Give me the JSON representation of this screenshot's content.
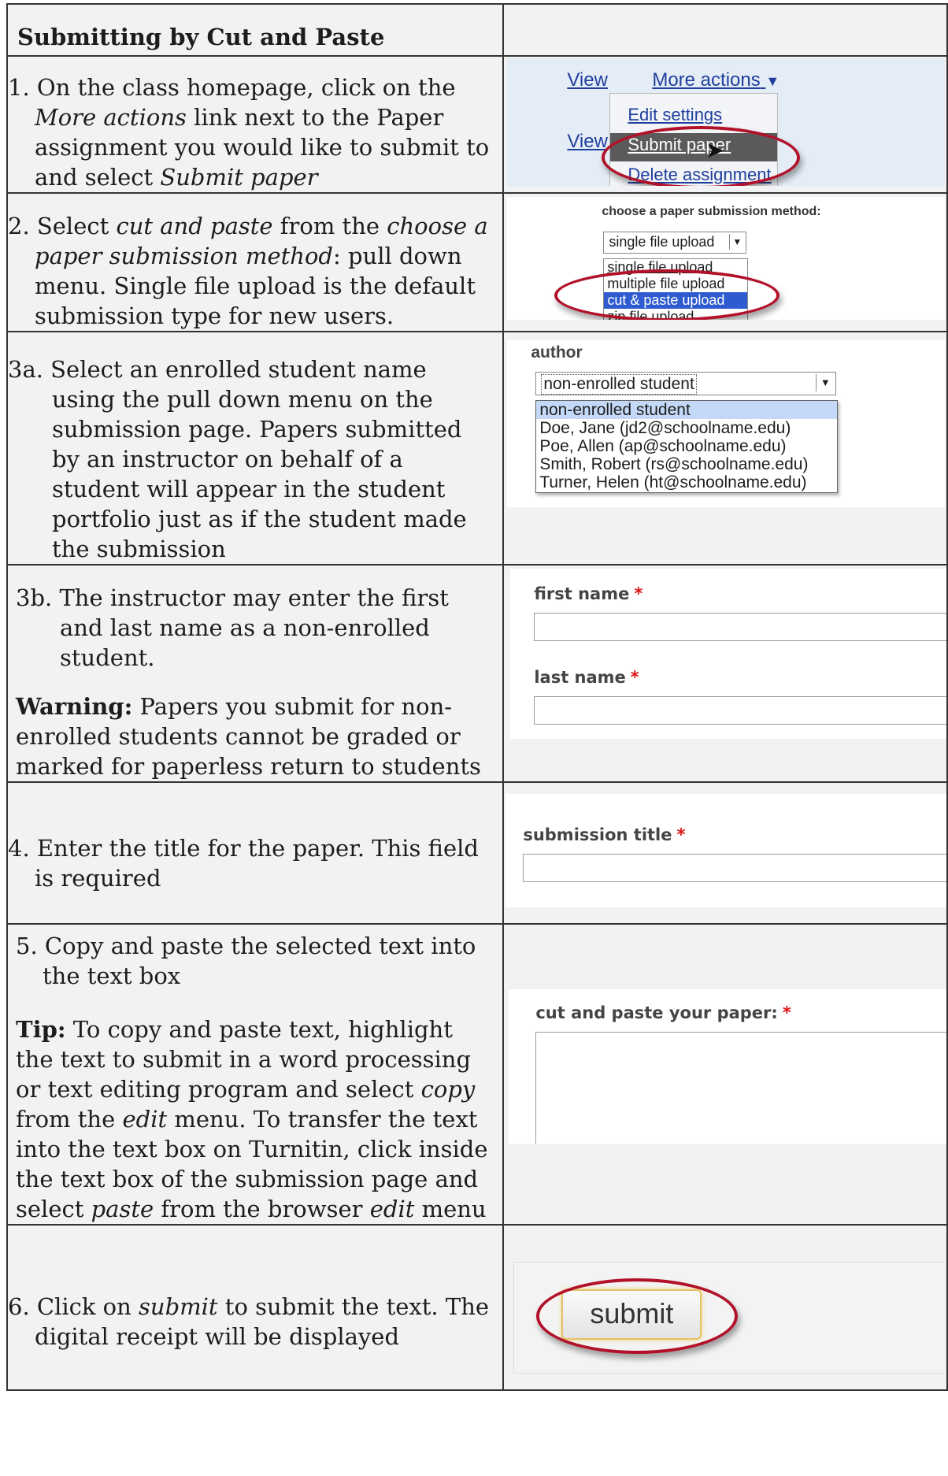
{
  "header": {
    "title": "Submitting by Cut and Paste"
  },
  "steps": {
    "s1": {
      "a": "1. On the class homepage, click on the ",
      "b": "More actions",
      "c": " link next to the Paper assignment you would like to submit to and select ",
      "d": "Submit paper"
    },
    "s2": {
      "a": "2. Select ",
      "b": "cut and paste",
      "c": " from the ",
      "d": "choose a paper submission method",
      "e": ": pull down menu. Single file upload is the default submission type for new users."
    },
    "s3a": {
      "text": "3a. Select an enrolled student name using the pull down menu on the submission page. Papers submitted by an instructor on behalf of a student will appear in the student portfolio just as if the student made the submission"
    },
    "s3b": {
      "text": "3b. The instructor may enter the first and last name as a non-enrolled student.",
      "warn_label": "Warning:",
      "warn_text": " Papers you submit for non-enrolled students cannot be graded or marked for paperless return to students"
    },
    "s4": {
      "text": "4. Enter the title for the paper. This field is required"
    },
    "s5": {
      "text": "5. Copy and paste the selected text into the text box",
      "tip_label": "Tip:",
      "tip_a": " To copy and paste text, highlight the text to submit in a word processing or text editing program and select ",
      "tip_b": "copy",
      "tip_c": " from the ",
      "tip_d": "edit",
      "tip_e": " menu.  To transfer the text into the text box on Turnitin, click inside the text box of the submission page and select ",
      "tip_f": "paste",
      "tip_g": " from the browser ",
      "tip_h": "edit",
      "tip_i": " menu"
    },
    "s6": {
      "a": "6. Click on ",
      "b": "submit",
      "c": " to submit the text. The digital receipt will be displayed"
    }
  },
  "shots": {
    "more_actions": {
      "view1": "View",
      "view2": "View",
      "more": "More actions",
      "menu": [
        "Edit settings",
        "Submit paper",
        "Delete assignment"
      ]
    },
    "method": {
      "label": "choose a paper submission method:",
      "selected": "single file upload",
      "options": [
        "single file upload",
        "multiple file upload",
        "cut & paste upload",
        "zip file upload"
      ]
    },
    "author": {
      "label": "author",
      "selected": "non-enrolled student",
      "options": [
        "non-enrolled student",
        "Doe, Jane (jd2@schoolname.edu)",
        "Poe, Allen (ap@schoolname.edu)",
        "Smith, Robert (rs@schoolname.edu)",
        "Turner, Helen (ht@schoolname.edu)"
      ]
    },
    "names": {
      "first": "first name",
      "last": "last name",
      "req": "*"
    },
    "title_field": {
      "label": "submission title",
      "req": "*"
    },
    "paste_field": {
      "label": "cut and paste your paper:",
      "req": "*"
    },
    "submit": {
      "label": "submit"
    }
  }
}
